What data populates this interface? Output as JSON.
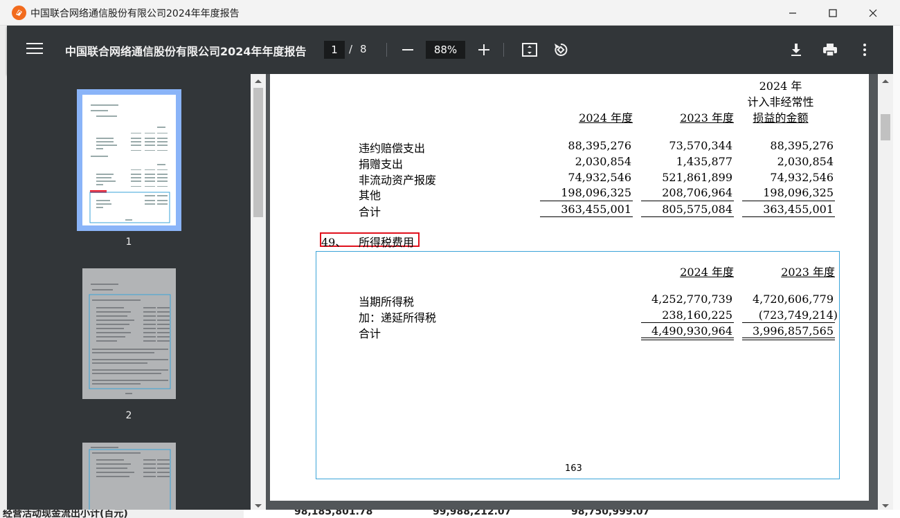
{
  "window": {
    "title": "中国联合网络通信股份有限公司2024年年度报告"
  },
  "toolbar": {
    "doc_title": "中国联合网络通信股份有限公司2024年年度报告",
    "page_current": "1",
    "page_sep": "/",
    "page_total": "8",
    "zoom": "88%"
  },
  "thumbnails": [
    {
      "label": "1"
    },
    {
      "label": "2"
    }
  ],
  "document": {
    "page_number": "163",
    "t1": {
      "columns": [
        "2024 年度",
        "2023 年度"
      ],
      "col3": [
        "2024 年",
        "计入非经常性",
        "损益的金额"
      ],
      "rows": [
        {
          "label": "违约赔偿支出",
          "v": [
            "88,395,276",
            "73,570,344",
            "88,395,276"
          ]
        },
        {
          "label": "捐赠支出",
          "v": [
            "2,030,854",
            "1,435,877",
            "2,030,854"
          ]
        },
        {
          "label": "非流动资产报废",
          "v": [
            "74,932,546",
            "521,861,899",
            "74,932,546"
          ]
        },
        {
          "label": "其他",
          "v": [
            "198,096,325",
            "208,706,964",
            "198,096,325"
          ]
        }
      ],
      "total": {
        "label": "合计",
        "v": [
          "363,455,001",
          "805,575,084",
          "363,455,001"
        ]
      }
    },
    "section": {
      "number": "49、",
      "title": "所得税费用"
    },
    "t2": {
      "columns": [
        "2024 年度",
        "2023 年度"
      ],
      "rows": [
        {
          "label": "当期所得税",
          "v": [
            "4,252,770,739",
            "4,720,606,779"
          ]
        },
        {
          "label": "加：递延所得税",
          "v": [
            "238,160,225",
            "(723,749,214)"
          ]
        }
      ],
      "total": {
        "label": "合计",
        "v": [
          "4,490,930,964",
          "3,996,857,565"
        ]
      }
    }
  },
  "background": {
    "left_text": "经营活动现金流出小计(百元)",
    "values": [
      "98,185,801.78",
      "99,988,212.07",
      "98,750,999.07"
    ]
  }
}
